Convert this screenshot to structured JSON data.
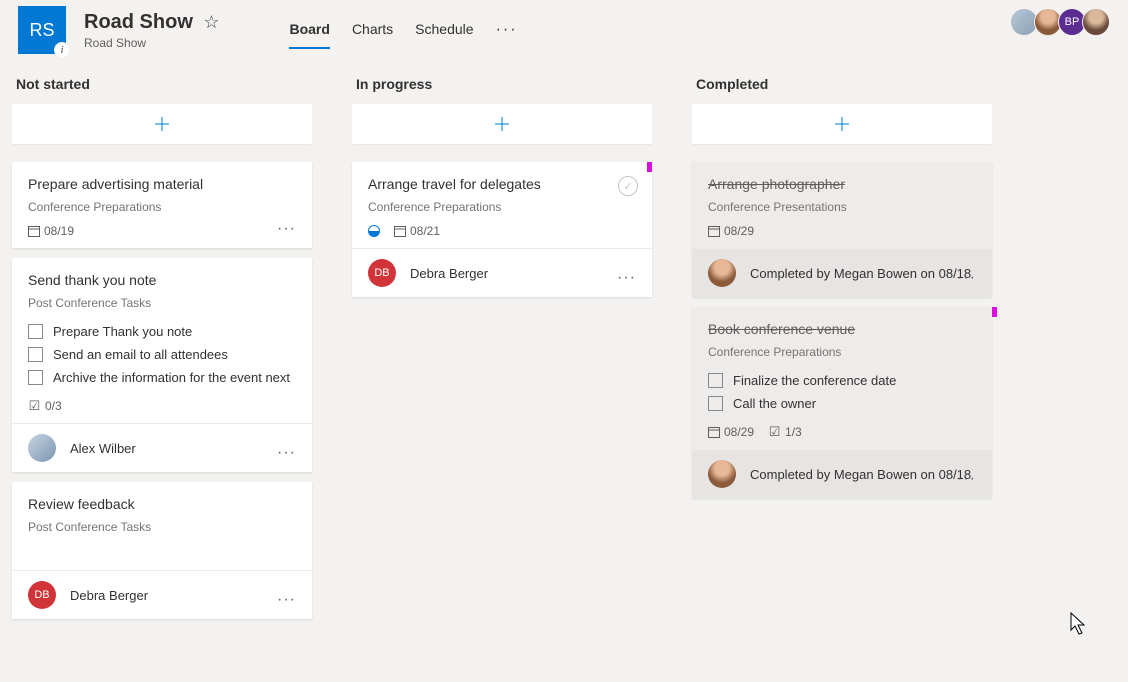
{
  "header": {
    "badge": "RS",
    "title": "Road Show",
    "group": "Road Show",
    "tabs": [
      "Board",
      "Charts",
      "Schedule"
    ],
    "members": {
      "bp": "BP"
    }
  },
  "columns": [
    {
      "title": "Not started",
      "cards": [
        {
          "title": "Prepare advertising material",
          "bucket": "Conference Preparations",
          "date": "08/19"
        },
        {
          "title": "Send thank you note",
          "bucket": "Post Conference Tasks",
          "checklist": [
            "Prepare Thank you note",
            "Send an email to all attendees",
            "Archive the information for the event next"
          ],
          "checkcount": "0/3",
          "assignee": {
            "initials": "",
            "name": "Alex Wilber",
            "cls": "aw"
          }
        },
        {
          "title": "Review feedback",
          "bucket": "Post Conference Tasks",
          "assignee": {
            "initials": "DB",
            "name": "Debra Berger",
            "cls": "db"
          }
        }
      ]
    },
    {
      "title": "In progress",
      "cards": [
        {
          "title": "Arrange travel for delegates",
          "bucket": "Conference Preparations",
          "date": "08/21",
          "progress": true,
          "marker": true,
          "completeCircle": true,
          "assignee": {
            "initials": "DB",
            "name": "Debra Berger",
            "cls": "db"
          }
        }
      ]
    },
    {
      "title": "Completed",
      "cards": [
        {
          "title": "Arrange photographer",
          "bucket": "Conference Presentations",
          "date": "08/29",
          "done": true,
          "completedBy": "Completed by Megan Bowen on 08/18"
        },
        {
          "title": "Book conference venue",
          "bucket": "Conference Preparations",
          "checklist": [
            "Finalize the conference date",
            "Call the owner"
          ],
          "date": "08/29",
          "checkcount": "1/3",
          "done": true,
          "markerOut": true,
          "completedBy": "Completed by Megan Bowen on 08/18"
        }
      ]
    }
  ]
}
